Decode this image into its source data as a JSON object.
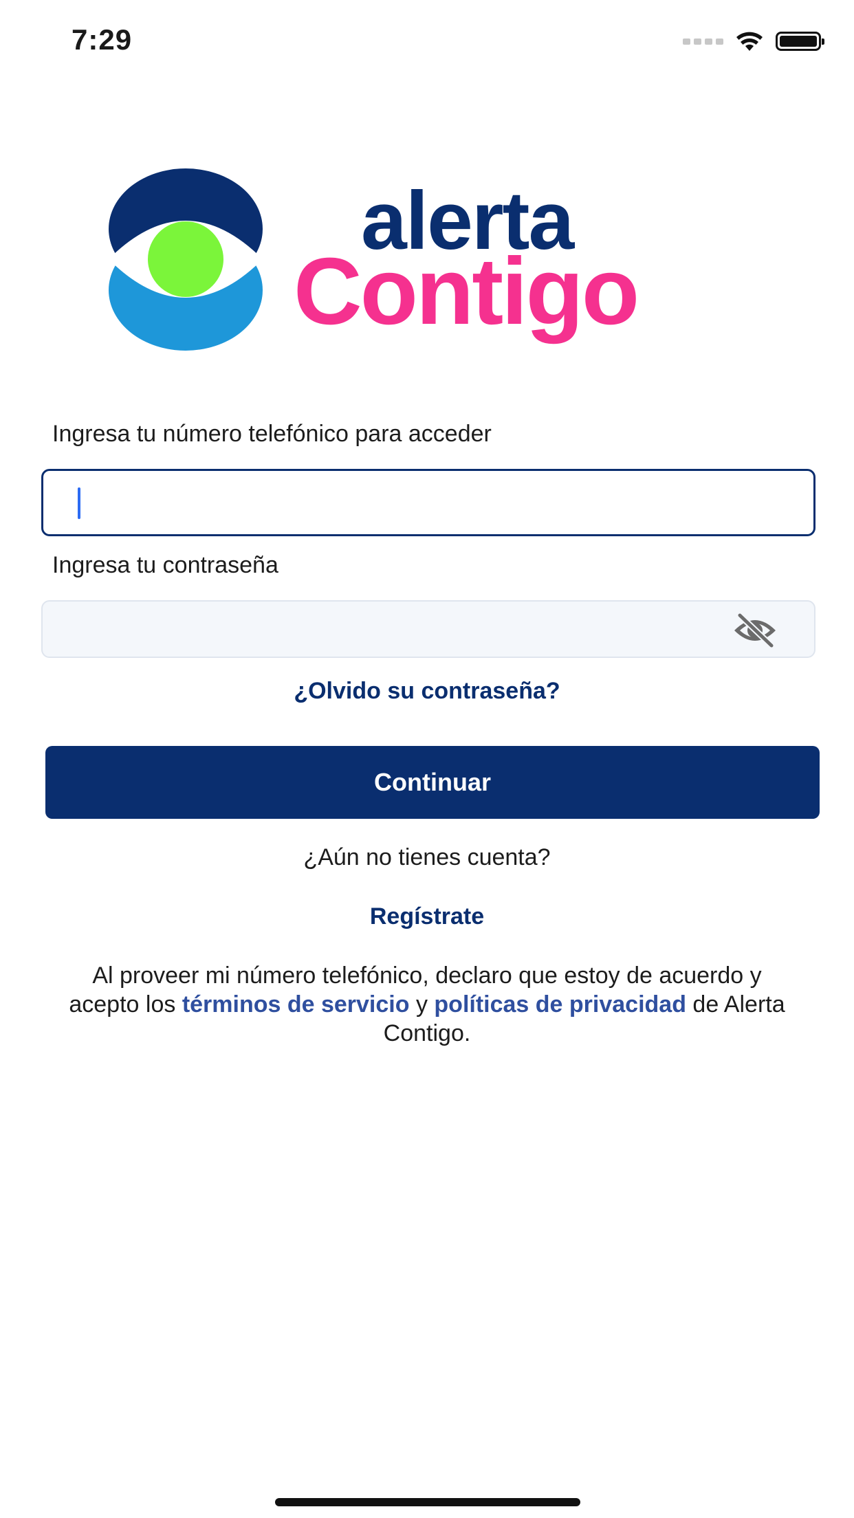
{
  "status_bar": {
    "time": "7:29"
  },
  "logo": {
    "word1": "alerta",
    "word2": "Contigo"
  },
  "login": {
    "phone_label": "Ingresa tu número telefónico para acceder",
    "phone_value": "",
    "password_label": "Ingresa tu contraseña",
    "password_value": "",
    "forgot_password": "¿Olvido su contraseña?",
    "continue_button": "Continuar",
    "no_account": "¿Aún no tienes cuenta?",
    "register_link": "Regístrate"
  },
  "terms": {
    "line1": "Al proveer mi número telefónico, declaro que estoy de acuerdo y acepto los",
    "terms_link": "términos de servicio",
    "conj": "y",
    "privacy_link": "políticas de privacidad",
    "tail": "de Alerta Contigo."
  },
  "colors": {
    "brand_navy": "#0a2e6f",
    "brand_pink": "#f5318f",
    "brand_green": "#7bf53a",
    "brand_blue": "#1e97d9"
  }
}
